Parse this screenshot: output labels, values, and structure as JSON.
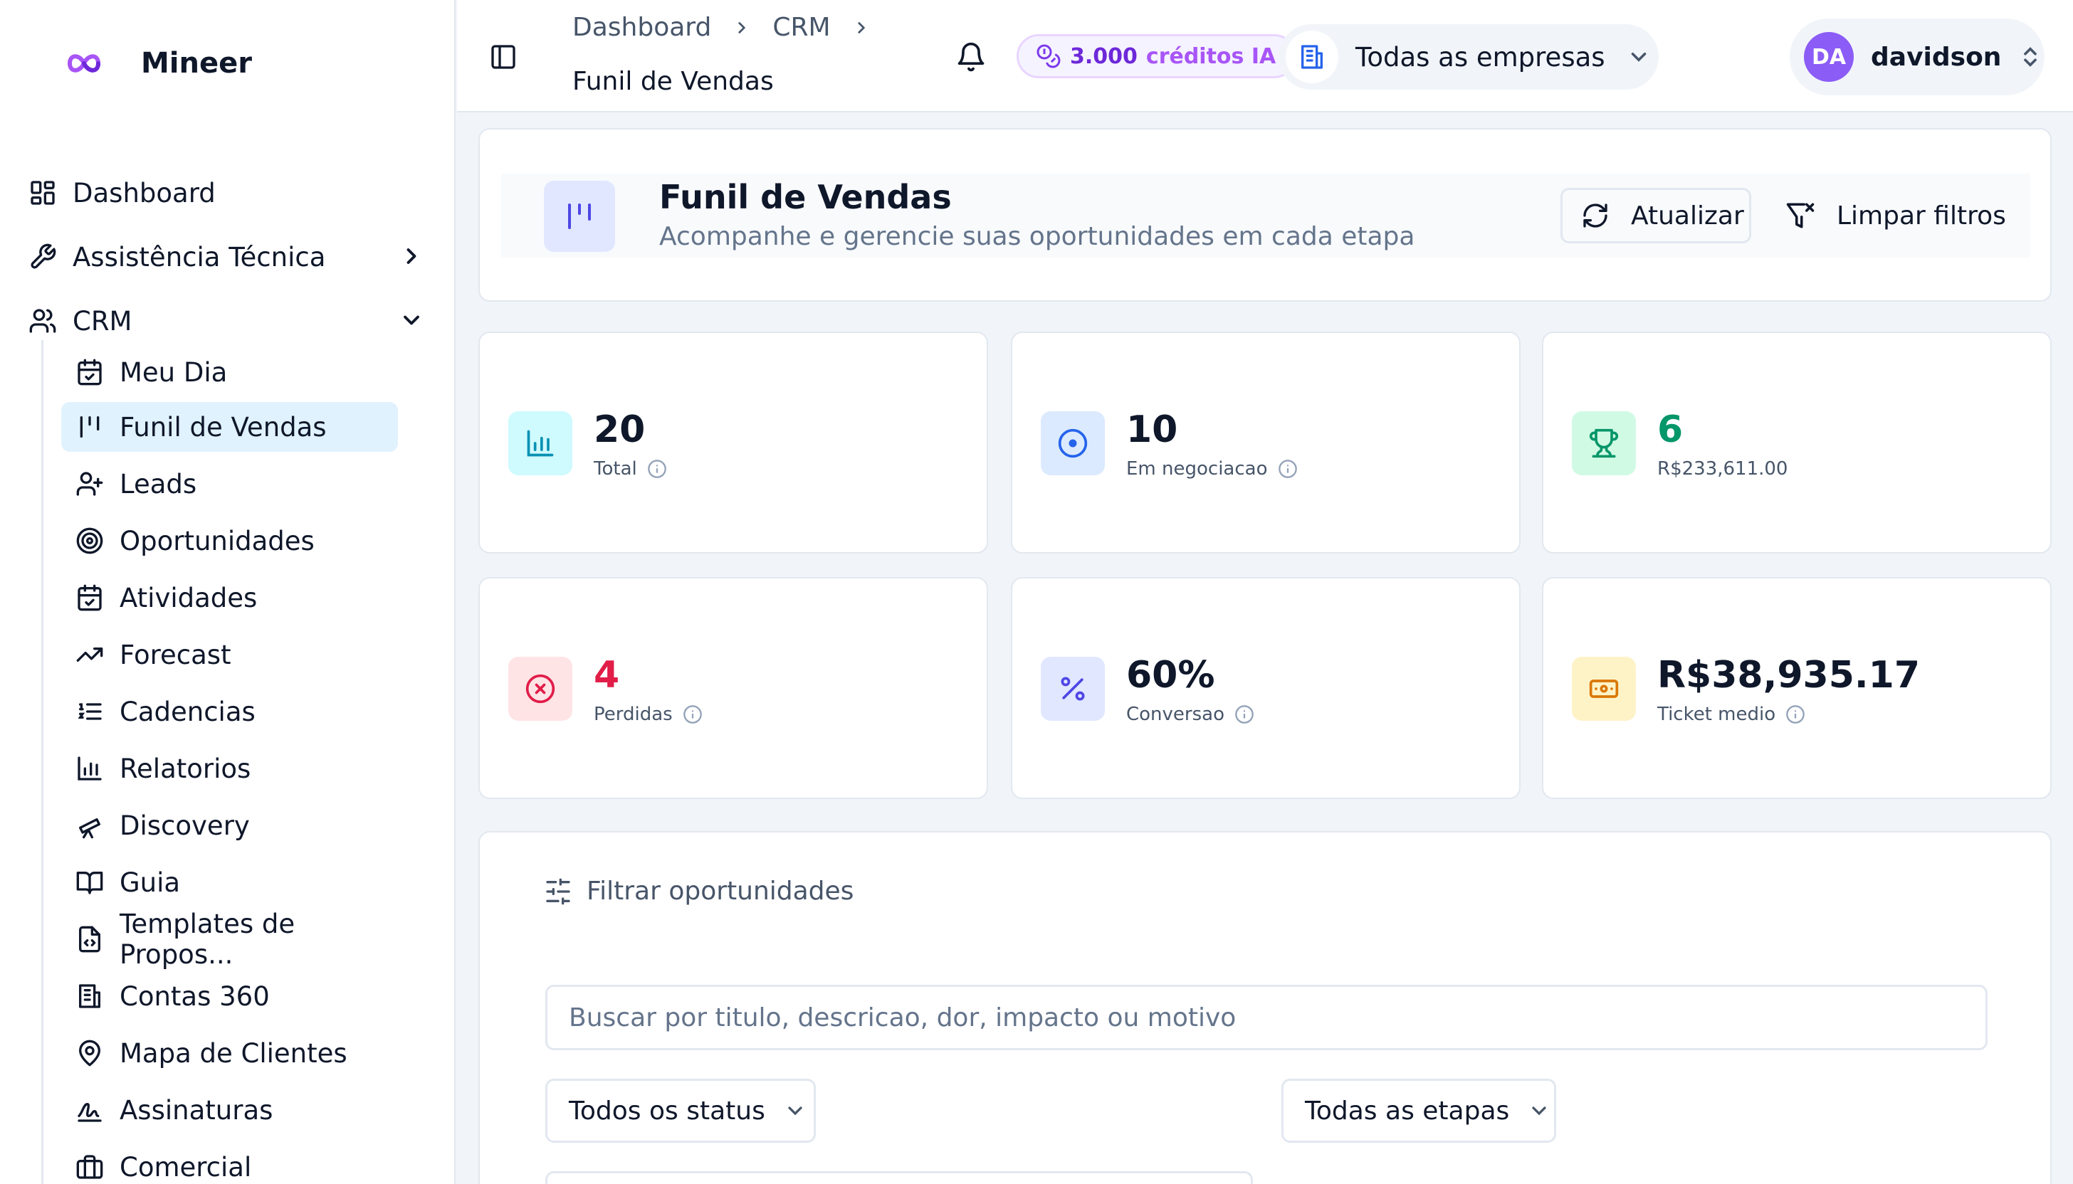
{
  "app": {
    "name": "Mineer"
  },
  "sidebar": {
    "top_items": [
      {
        "label": "Dashboard",
        "icon": "layout-grid-icon"
      },
      {
        "label": "Assistência Técnica",
        "icon": "wrench-icon"
      },
      {
        "label": "CRM",
        "icon": "users-icon"
      }
    ],
    "crm_items": [
      {
        "label": "Meu Dia",
        "icon": "calendar-check-icon"
      },
      {
        "label": "Funil de Vendas",
        "icon": "kanban-icon",
        "active": true
      },
      {
        "label": "Leads",
        "icon": "user-plus-icon"
      },
      {
        "label": "Oportunidades",
        "icon": "target-icon"
      },
      {
        "label": "Atividades",
        "icon": "calendar-check-icon"
      },
      {
        "label": "Forecast",
        "icon": "trending-up-icon"
      },
      {
        "label": "Cadencias",
        "icon": "list-ordered-icon"
      },
      {
        "label": "Relatorios",
        "icon": "bar-chart-icon"
      },
      {
        "label": "Discovery",
        "icon": "telescope-icon"
      },
      {
        "label": "Guia",
        "icon": "book-open-icon"
      },
      {
        "label": "Templates de Propos...",
        "icon": "file-code-icon"
      },
      {
        "label": "Contas 360",
        "icon": "building-icon"
      },
      {
        "label": "Mapa de Clientes",
        "icon": "map-pin-icon"
      },
      {
        "label": "Assinaturas",
        "icon": "signature-icon"
      },
      {
        "label": "Comercial",
        "icon": "briefcase-icon"
      }
    ]
  },
  "header": {
    "breadcrumb": [
      "Dashboard",
      "CRM"
    ],
    "current_page": "Funil de Vendas",
    "credits_value": "3.000",
    "credits_label": "créditos IA",
    "company_selector": "Todas as empresas",
    "user_initials": "DA",
    "user_name": "davidson"
  },
  "page": {
    "title": "Funil de Vendas",
    "subtitle": "Acompanhe e gerencie suas oportunidades em cada etapa",
    "refresh_label": "Atualizar",
    "clear_filters_label": "Limpar filtros"
  },
  "stats": [
    {
      "value": "20",
      "label": "Total",
      "icon": "bar-chart-icon",
      "color": "#0891b2",
      "bg": "#cffafe",
      "value_color": "#0f172a",
      "info": true
    },
    {
      "value": "10",
      "label": "Em negociacao",
      "icon": "target-icon",
      "color": "#2563eb",
      "bg": "#dbeafe",
      "value_color": "#0f172a",
      "info": true
    },
    {
      "value": "6",
      "label": "R$233,611.00",
      "icon": "trophy-icon",
      "color": "#059669",
      "bg": "#d1fae5",
      "value_color": "#059669",
      "info": false
    },
    {
      "value": "4",
      "label": "Perdidas",
      "icon": "x-circle-icon",
      "color": "#e11d48",
      "bg": "#ffe4e6",
      "value_color": "#e11d48",
      "info": true
    },
    {
      "value": "60%",
      "label": "Conversao",
      "icon": "percent-icon",
      "color": "#4f46e5",
      "bg": "#e0e7ff",
      "value_color": "#0f172a",
      "info": true
    },
    {
      "value": "R$38,935.17",
      "label": "Ticket medio",
      "icon": "banknote-icon",
      "color": "#d97706",
      "bg": "#fef3c7",
      "value_color": "#0f172a",
      "info": true
    }
  ],
  "filters": {
    "heading": "Filtrar oportunidades",
    "search_placeholder": "Buscar por titulo, descricao, dor, impacto ou motivo",
    "status_select": "Todos os status",
    "stage_select": "Todas as etapas"
  }
}
